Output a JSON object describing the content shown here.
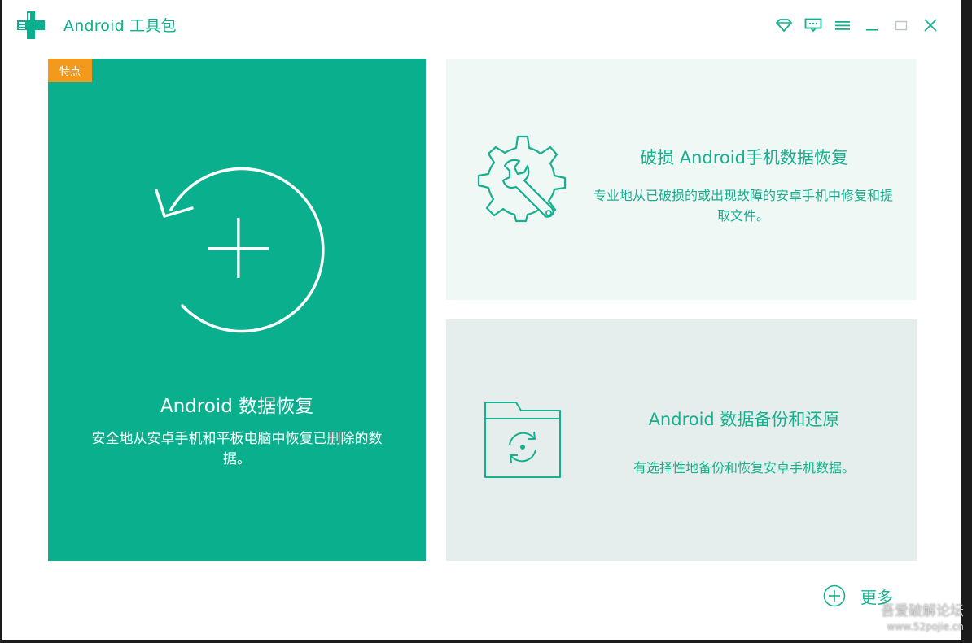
{
  "app": {
    "title": "Android 工具包",
    "logo_icon": "medical-plus-logo",
    "accent_color": "#0ab08d"
  },
  "window_controls": [
    {
      "icon": "diamond-icon"
    },
    {
      "icon": "feedback-icon"
    },
    {
      "icon": "menu-icon"
    },
    {
      "icon": "minimize-icon"
    },
    {
      "icon": "maximize-icon"
    },
    {
      "icon": "close-icon"
    }
  ],
  "cards": {
    "recover": {
      "badge": "特点",
      "badge_color": "#f39a1c",
      "title": "Android 数据恢复",
      "description": "安全地从安卓手机和平板电脑中恢复已删除的数据。",
      "icon": "restore-plus-icon"
    },
    "repair": {
      "title": "破损 Android手机数据恢复",
      "description": "专业地从已破损的或出现故障的安卓手机中修复和提取文件。",
      "icon": "gear-wrench-icon"
    },
    "backup": {
      "title": "Android 数据备份和还原",
      "description": "有选择性地备份和恢复安卓手机数据。",
      "icon": "folder-sync-icon"
    }
  },
  "more": {
    "label": "更多",
    "icon": "plus-circle-icon"
  },
  "watermark": {
    "line1": "吾爱破解论坛",
    "line2": "www.52pojie.cn"
  }
}
